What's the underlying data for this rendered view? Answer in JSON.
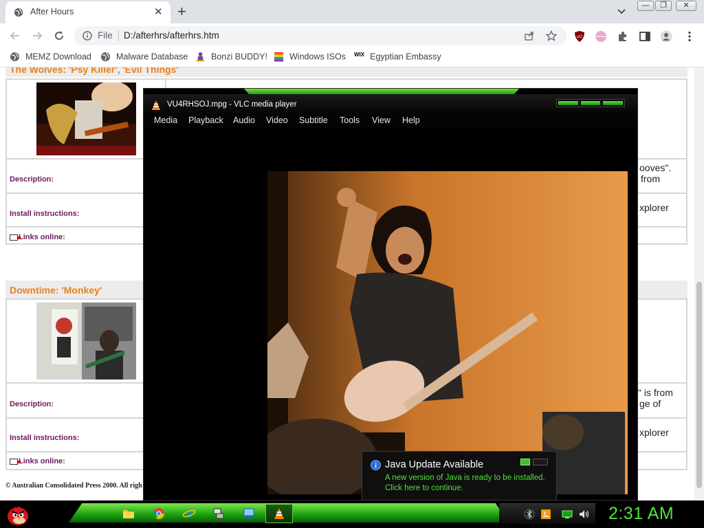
{
  "browser": {
    "tab_title": "After Hours",
    "address_scheme": "File",
    "address_url": "D:/afterhrs/afterhrs.htm",
    "bookmarks": [
      {
        "label": "MEMZ Download",
        "icon": "globe-icon"
      },
      {
        "label": "Malware Database",
        "icon": "globe-icon"
      },
      {
        "label": "Bonzi BUDDY!",
        "icon": "bonzi-icon"
      },
      {
        "label": "Windows ISOs",
        "icon": "windows-flag-icon"
      },
      {
        "label": "Egyptian Embassy",
        "icon": "wix-icon"
      }
    ],
    "wix_badge": "WIX"
  },
  "page": {
    "band1_title": "The Wolves: 'Psy Killer', 'Evil Things'",
    "band2_title": "Downtime: 'Monkey'",
    "description_label": "Description:",
    "install_label": "Install instructions:",
    "links_label": "Links online:",
    "frag_grooves": "ooves\".",
    "frag_from": "from",
    "frag_explorer": "xplorer",
    "frag_isfrom": "\" is from",
    "frag_geof": "ge of",
    "frag_explorer2": "xplorer",
    "footer": "© Australian Consolidated Press 2000. All righ"
  },
  "vlc": {
    "title": "VU4RHSOJ.mpg - VLC media player",
    "menus": [
      "Media",
      "Playback",
      "Audio",
      "Video",
      "Subtitle",
      "Tools",
      "View",
      "Help"
    ]
  },
  "notification": {
    "title": "Java Update Available",
    "line1": "A new version of Java is ready to be installed.",
    "line2": "Click here to continue."
  },
  "taskbar": {
    "clock": "2:31 AM",
    "apps": [
      "file-explorer-icon",
      "chrome-icon",
      "internet-explorer-icon",
      "network-icon",
      "control-panel-icon",
      "vlc-icon"
    ]
  },
  "colors": {
    "accent_green": "#4fe23a",
    "band_title_orange": "#e8801a",
    "row_label_purple": "#6a1b5e"
  }
}
